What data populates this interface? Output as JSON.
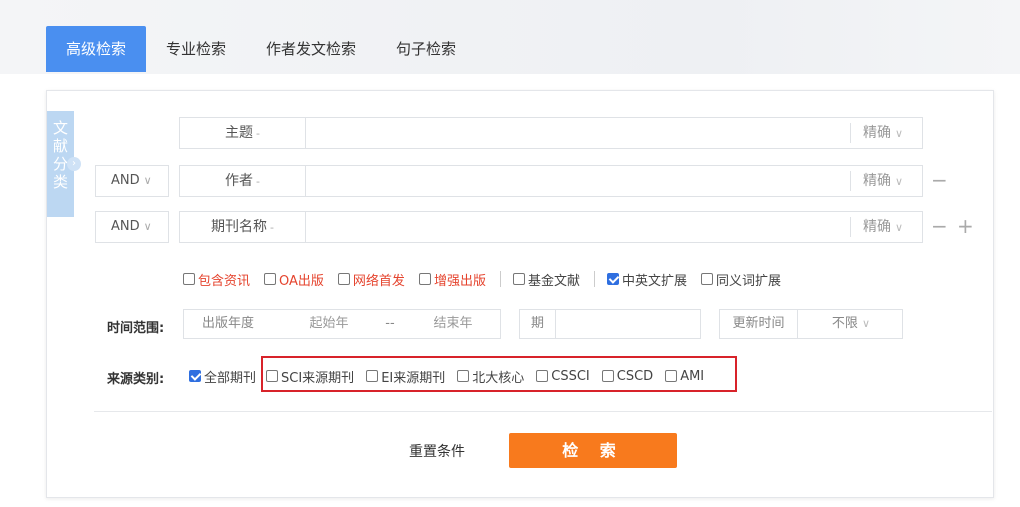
{
  "tabs": [
    {
      "label": "高级检索"
    },
    {
      "label": "专业检索"
    },
    {
      "label": "作者发文检索"
    },
    {
      "label": "句子检索"
    }
  ],
  "side_tag": {
    "chars": [
      "文",
      "献",
      "分",
      "类"
    ],
    "arrow": "›"
  },
  "rows": [
    {
      "logic": "",
      "field": "主题",
      "match": "精确",
      "value": ""
    },
    {
      "logic": "AND",
      "field": "作者",
      "match": "精确",
      "value": ""
    },
    {
      "logic": "AND",
      "field": "期刊名称",
      "match": "精确",
      "value": ""
    }
  ],
  "dropdown_glyph": "∨",
  "field_glyph": "-",
  "options": [
    {
      "label": "包含资讯",
      "checked": false,
      "color": "#e5432d"
    },
    {
      "label": "OA出版",
      "checked": false,
      "color": "#e5432d"
    },
    {
      "label": "网络首发",
      "checked": false,
      "color": "#e5432d"
    },
    {
      "label": "增强出版",
      "checked": false,
      "color": "#e5432d"
    },
    {
      "label": "基金文献",
      "checked": false,
      "color": "#444444"
    },
    {
      "label": "中英文扩展",
      "checked": true,
      "color": "#444444"
    },
    {
      "label": "同义词扩展",
      "checked": false,
      "color": "#444444"
    }
  ],
  "time": {
    "label": "时间范围:",
    "pub_year_label": "出版年度",
    "start_placeholder": "起始年",
    "dash": "--",
    "end_placeholder": "结束年",
    "issue_label": "期",
    "update_label": "更新时间",
    "update_value": "不限"
  },
  "source": {
    "label": "来源类别:",
    "items": [
      {
        "label": "全部期刊",
        "checked": true
      },
      {
        "label": "SCI来源期刊",
        "checked": false
      },
      {
        "label": "EI来源期刊",
        "checked": false
      },
      {
        "label": "北大核心",
        "checked": false
      },
      {
        "label": "CSSCI",
        "checked": false
      },
      {
        "label": "CSCD",
        "checked": false
      },
      {
        "label": "AMI",
        "checked": false
      }
    ]
  },
  "actions": {
    "reset": "重置条件",
    "search": "检 索"
  },
  "row_buttons": {
    "minus": "−",
    "plus": "+"
  },
  "colors": {
    "tab_active": "#4a8ff0",
    "search_button": "#f87a1d",
    "highlight_border": "#d8232a",
    "checkbox_checked": "#2f6fe0"
  }
}
